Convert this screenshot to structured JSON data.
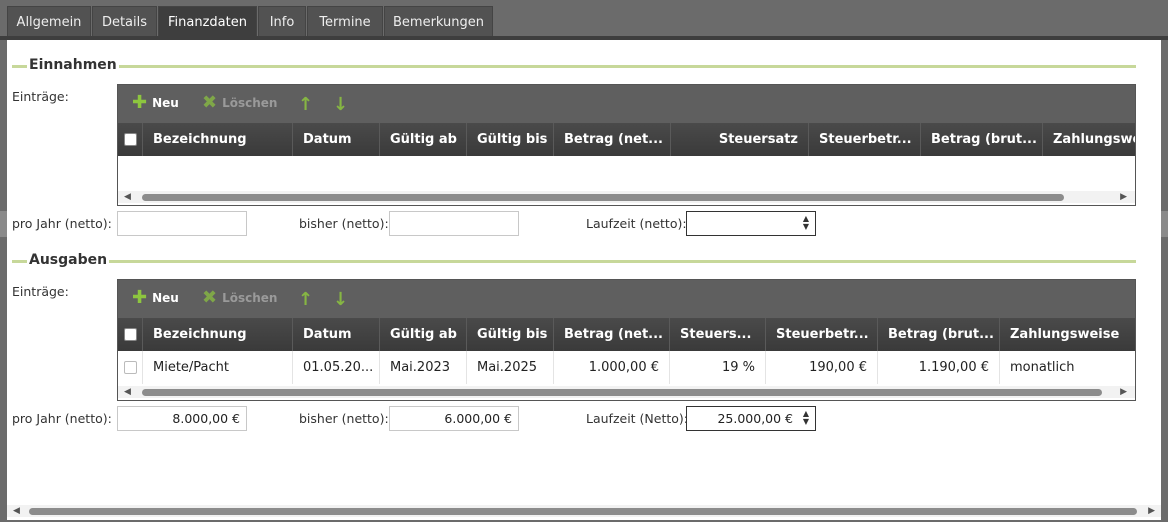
{
  "tabs": [
    {
      "label": "Allgemein"
    },
    {
      "label": "Details"
    },
    {
      "label": "Finanzdaten"
    },
    {
      "label": "Info"
    },
    {
      "label": "Termine"
    },
    {
      "label": "Bemerkungen"
    }
  ],
  "active_tab": "Finanzdaten",
  "einnahmen": {
    "title": "Einnahmen",
    "entries_label": "Einträge:",
    "toolbar": {
      "new": "Neu",
      "delete": "Löschen"
    },
    "columns": [
      "Bezeichnung",
      "Datum",
      "Gültig ab",
      "Gültig bis",
      "Betrag (net...",
      "Steuersatz",
      "Steuerbetr...",
      "Betrag (brut...",
      "Zahlungsweise"
    ],
    "rows": [],
    "per_year_label": "pro Jahr (netto):",
    "per_year_value": "",
    "so_far_label": "bisher (netto):",
    "so_far_value": "",
    "runtime_label": "Laufzeit (netto):",
    "runtime_value": ""
  },
  "ausgaben": {
    "title": "Ausgaben",
    "entries_label": "Einträge:",
    "toolbar": {
      "new": "Neu",
      "delete": "Löschen"
    },
    "columns": [
      "Bezeichnung",
      "Datum",
      "Gültig ab",
      "Gültig bis",
      "Betrag (net...",
      "Steuers...",
      "Steuerbetr...",
      "Betrag (brut...",
      "Zahlungsweise"
    ],
    "rows": [
      {
        "bezeichnung": "Miete/Pacht",
        "datum": "01.05.20...",
        "gueltig_ab": "Mai.2023",
        "gueltig_bis": "Mai.2025",
        "betrag_netto": "1.000,00 €",
        "steuersatz": "19 %",
        "steuerbetrag": "190,00 €",
        "betrag_brutto": "1.190,00 €",
        "zahlungsweise": "monatlich"
      }
    ],
    "per_year_label": "pro Jahr (netto):",
    "per_year_value": "8.000,00 €",
    "so_far_label": "bisher (netto):",
    "so_far_value": "6.000,00 €",
    "runtime_label": "Laufzeit (Netto):",
    "runtime_value": "25.000,00 €"
  },
  "colors": {
    "accent": "#8dc63f",
    "header_bg": "#3e3e3e",
    "toolbar_bg": "#5f5f5f",
    "section_line": "#c7d89a"
  }
}
